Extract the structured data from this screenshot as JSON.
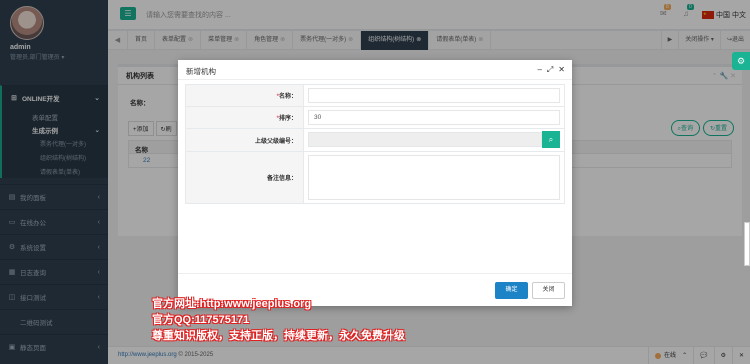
{
  "sidebar": {
    "username": "admin",
    "role": "管理员,部门管理员 ▾",
    "online_dev": "ONLINE开发",
    "form_config": "表单配置",
    "gen_example": "生成示例",
    "sub_items": [
      "票务代理(一对多)",
      "组织结构(树结构)",
      "请假表单(单表)"
    ],
    "menu": [
      "我的面板",
      "在线办公",
      "系统设置",
      "日志查询",
      "接口测试",
      "二维码测试",
      "静态页面"
    ]
  },
  "topbar": {
    "search_placeholder": "请输入您需要查找的内容 ...",
    "mail_count": "8",
    "bell_count": "0",
    "language": "中国 中文"
  },
  "tabs": {
    "items": [
      "首页",
      "表单配置",
      "菜单管理",
      "角色管理",
      "票务代理(一对多)",
      "组织结构(树结构)",
      "请假表单(单表)"
    ],
    "close_ops": "关闭操作 ▾",
    "logout": "退出"
  },
  "background": {
    "panel_title": "机构列表",
    "name_label": "名称：",
    "add": "添加",
    "refresh": "刷",
    "query": "查询",
    "reset": "重置",
    "col_name": "名称",
    "row_value": "22"
  },
  "modal": {
    "title": "新增机构",
    "fields": {
      "name_label": "名称：",
      "sort_label": "排序：",
      "sort_value": "30",
      "parent_label": "上级父级编号：",
      "remarks_label": "备注信息："
    },
    "ok": "确定",
    "close": "关闭"
  },
  "watermark": {
    "line1": "官方网址:http:www.jeeplus.org",
    "line2": "官方QQ:117575171",
    "line3": "尊重知识版权，支持正版，持续更新，永久免费升级"
  },
  "footer": {
    "link": "http://www.jeeplus.org",
    "copyright": " © 2015-2025",
    "online": "在线"
  }
}
